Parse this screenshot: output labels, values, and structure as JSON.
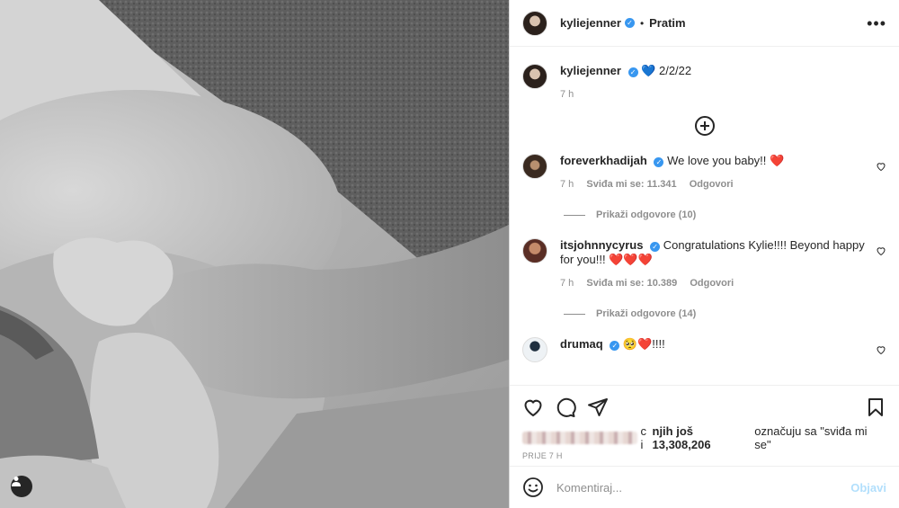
{
  "post": {
    "author": "kyliejenner",
    "follow_label": "Pratim",
    "more_label": "•••",
    "caption": {
      "author": "kyliejenner",
      "text": "💙 2/2/22",
      "age": "7 h"
    }
  },
  "comments": [
    {
      "author": "foreverkhadijah",
      "text": "We love you baby!! ❤️",
      "age": "7 h",
      "likes": "Sviđa mi se: 11.341",
      "reply_label": "Odgovori",
      "replies_label": "Prikaži odgovore (10)"
    },
    {
      "author": "itsjohnnycyrus",
      "text": "Congratulations Kylie!!!! Beyond happy for you!!! ❤️❤️❤️",
      "age": "7 h",
      "likes": "Sviđa mi se: 10.389",
      "reply_label": "Odgovori",
      "replies_label": "Prikaži odgovore (14)"
    },
    {
      "author": "drumaq",
      "text": "🥺❤️!!!!"
    }
  ],
  "likes_line": {
    "suffix_plain": "c i ",
    "bold": "njih još 13,308,206",
    "rest": " označuju sa \"sviđa mi se\""
  },
  "timestamp": "PRIJE 7 H",
  "composer": {
    "placeholder": "Komentiraj...",
    "post_label": "Objavi"
  },
  "icons": [
    "tag-user-icon",
    "heart-icon",
    "comment-icon",
    "share-icon",
    "bookmark-icon",
    "emoji-icon",
    "add-circle-icon",
    "verified-icon"
  ],
  "colors": {
    "verified": "#3897f0",
    "post_button_disabled": "#b2dffc",
    "muted_text": "#8e8e8e"
  }
}
